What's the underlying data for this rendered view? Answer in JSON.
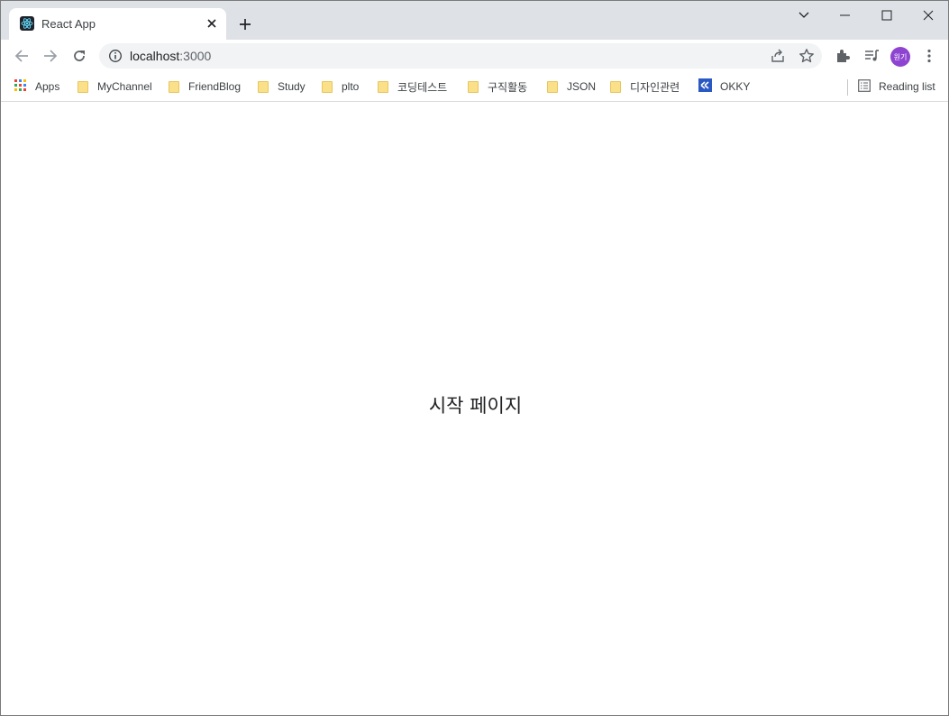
{
  "tab": {
    "title": "React App",
    "close_icon": "close-icon",
    "favicon": "react-icon"
  },
  "new_tab_icon": "plus-icon",
  "window_controls": [
    "chevron-down-icon",
    "minimize-icon",
    "maximize-icon",
    "close-icon"
  ],
  "address_bar": {
    "host": "localhost",
    "port": ":3000",
    "info_icon": "info-icon",
    "share_icon": "share-icon",
    "star_icon": "star-icon"
  },
  "profile": {
    "initials": "원기",
    "color": "#8e44d1"
  },
  "bookmarks": {
    "apps_label": "Apps",
    "items": [
      "MyChannel",
      "FriendBlog",
      "Study",
      "plto",
      "코딩테스트",
      "구직활동",
      "JSON",
      "디자인관련",
      "OKKY"
    ],
    "reading_list": "Reading list"
  },
  "page": {
    "heading": "시작 페이지"
  }
}
